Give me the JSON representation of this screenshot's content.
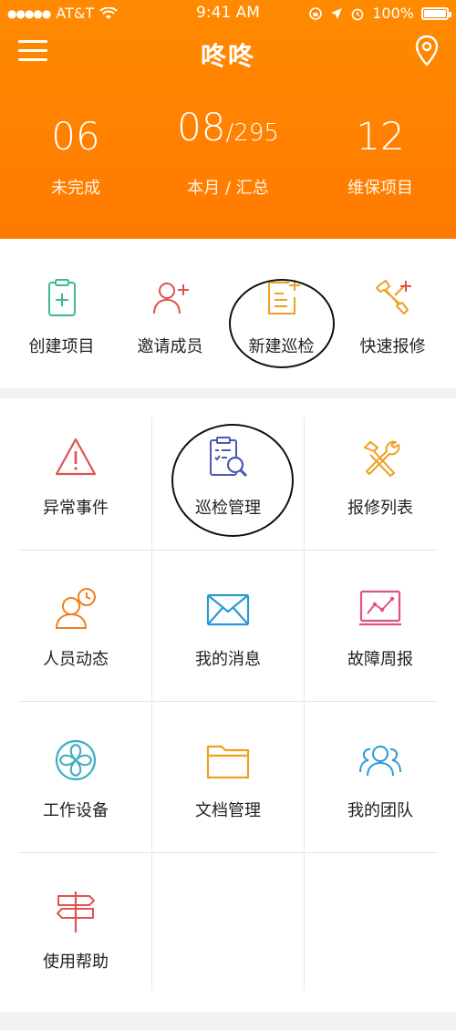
{
  "status_bar": {
    "carrier": "AT&T",
    "time": "9:41 AM",
    "battery": "100%"
  },
  "nav": {
    "title": "咚咚"
  },
  "stats": [
    {
      "value": "06",
      "label": "未完成"
    },
    {
      "value": "08",
      "total": "/295",
      "label": "本月 / 汇总"
    },
    {
      "value": "12",
      "label": "维保项目"
    }
  ],
  "quick_actions": [
    {
      "label": "创建项目",
      "icon": "clipboard-plus-icon"
    },
    {
      "label": "邀请成员",
      "icon": "add-user-icon"
    },
    {
      "label": "新建巡检",
      "icon": "new-inspection-icon"
    },
    {
      "label": "快速报修",
      "icon": "repair-tools-icon"
    }
  ],
  "grid": [
    {
      "label": "异常事件",
      "icon": "warning-icon"
    },
    {
      "label": "巡检管理",
      "icon": "inspection-search-icon"
    },
    {
      "label": "报修列表",
      "icon": "hammer-wrench-icon"
    },
    {
      "label": "人员动态",
      "icon": "user-clock-icon"
    },
    {
      "label": "我的消息",
      "icon": "mail-icon"
    },
    {
      "label": "故障周报",
      "icon": "chart-board-icon"
    },
    {
      "label": "工作设备",
      "icon": "fan-icon"
    },
    {
      "label": "文档管理",
      "icon": "folder-icon"
    },
    {
      "label": "我的团队",
      "icon": "team-icon"
    },
    {
      "label": "使用帮助",
      "icon": "signpost-icon"
    }
  ],
  "colors": {
    "header": "#ff7f00",
    "green": "#3cb98e",
    "red": "#e0534e",
    "orange": "#f0a020",
    "blue": "#4a5ab0",
    "pink": "#e0508a",
    "teal": "#3aaec0",
    "sky": "#2a9ad6"
  }
}
